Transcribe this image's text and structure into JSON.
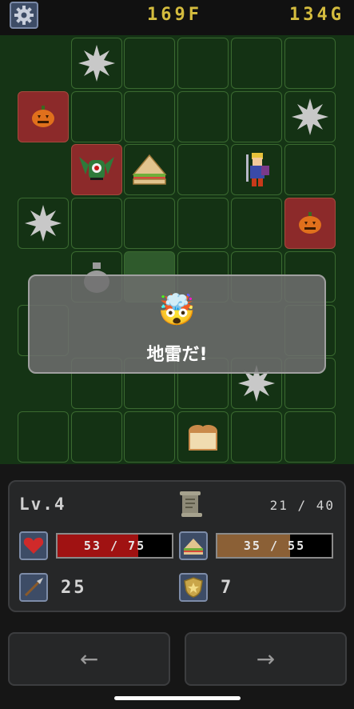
{
  "header": {
    "floor": "169F",
    "gold": "134G"
  },
  "board": {
    "cells": [
      {
        "col": 1,
        "row": 0,
        "bg": "",
        "item": "spike-icon"
      },
      {
        "col": 2,
        "row": 0,
        "bg": "",
        "item": ""
      },
      {
        "col": 3,
        "row": 0,
        "bg": "",
        "item": ""
      },
      {
        "col": 4,
        "row": 0,
        "bg": "",
        "item": ""
      },
      {
        "col": 5,
        "row": 0,
        "bg": "",
        "item": ""
      },
      {
        "col": 0,
        "row": 1,
        "bg": "red",
        "item": "pumpkin-icon"
      },
      {
        "col": 1,
        "row": 1,
        "bg": "",
        "item": ""
      },
      {
        "col": 2,
        "row": 1,
        "bg": "",
        "item": ""
      },
      {
        "col": 3,
        "row": 1,
        "bg": "",
        "item": ""
      },
      {
        "col": 4,
        "row": 1,
        "bg": "",
        "item": ""
      },
      {
        "col": 5,
        "row": 1,
        "bg": "",
        "item": "spike-icon"
      },
      {
        "col": 1,
        "row": 2,
        "bg": "red",
        "item": "bat-monster-icon"
      },
      {
        "col": 2,
        "row": 2,
        "bg": "",
        "item": "sandwich-icon"
      },
      {
        "col": 3,
        "row": 2,
        "bg": "",
        "item": ""
      },
      {
        "col": 4,
        "row": 2,
        "bg": "",
        "item": "hero-icon"
      },
      {
        "col": 5,
        "row": 2,
        "bg": "",
        "item": ""
      },
      {
        "col": 0,
        "row": 3,
        "bg": "",
        "item": "spike-icon"
      },
      {
        "col": 1,
        "row": 3,
        "bg": "",
        "item": ""
      },
      {
        "col": 2,
        "row": 3,
        "bg": "",
        "item": ""
      },
      {
        "col": 3,
        "row": 3,
        "bg": "",
        "item": ""
      },
      {
        "col": 4,
        "row": 3,
        "bg": "",
        "item": ""
      },
      {
        "col": 5,
        "row": 3,
        "bg": "red",
        "item": "pumpkin-icon"
      },
      {
        "col": 1,
        "row": 4,
        "bg": "",
        "item": "gold-bag-icon"
      },
      {
        "col": 2,
        "row": 4,
        "bg": "noise",
        "item": ""
      },
      {
        "col": 3,
        "row": 4,
        "bg": "",
        "item": ""
      },
      {
        "col": 4,
        "row": 4,
        "bg": "",
        "item": ""
      },
      {
        "col": 5,
        "row": 4,
        "bg": "",
        "item": ""
      },
      {
        "col": 0,
        "row": 5,
        "bg": "",
        "item": ""
      },
      {
        "col": 5,
        "row": 5,
        "bg": "",
        "item": ""
      },
      {
        "col": 1,
        "row": 6,
        "bg": "",
        "item": ""
      },
      {
        "col": 2,
        "row": 6,
        "bg": "",
        "item": ""
      },
      {
        "col": 3,
        "row": 6,
        "bg": "",
        "item": ""
      },
      {
        "col": 4,
        "row": 6,
        "bg": "",
        "item": "spike-icon"
      },
      {
        "col": 5,
        "row": 6,
        "bg": "",
        "item": ""
      },
      {
        "col": 0,
        "row": 7,
        "bg": "",
        "item": ""
      },
      {
        "col": 1,
        "row": 7,
        "bg": "",
        "item": ""
      },
      {
        "col": 2,
        "row": 7,
        "bg": "",
        "item": ""
      },
      {
        "col": 3,
        "row": 7,
        "bg": "",
        "item": "bread-icon"
      },
      {
        "col": 4,
        "row": 7,
        "bg": "",
        "item": ""
      },
      {
        "col": 5,
        "row": 7,
        "bg": "",
        "item": ""
      }
    ]
  },
  "modal": {
    "emoji": "🤯",
    "message": "地雷だ!"
  },
  "status": {
    "level": "Lv.4",
    "exp": "21 / 40",
    "hp": {
      "label": "53 / 75",
      "fraction": 0.707,
      "color": "#a01212"
    },
    "food": {
      "label": "35 / 55",
      "fraction": 0.636,
      "color": "#8b6036"
    },
    "attack": "25",
    "defense": "7"
  },
  "nav": {
    "left": "←",
    "right": "→"
  },
  "colors": {
    "accent_gold": "#d4bc3e",
    "icon_box": "#3d4c66",
    "cell_red": "#8c2a2a"
  }
}
